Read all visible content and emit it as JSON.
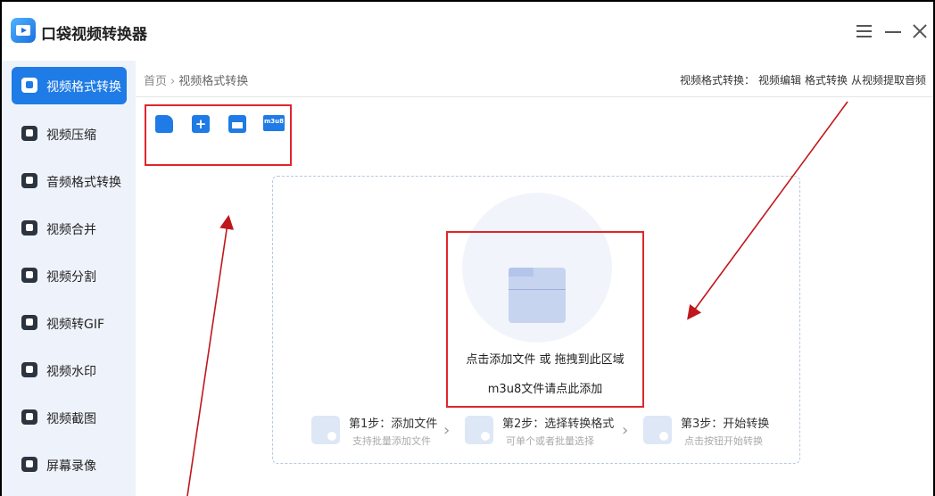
{
  "app": {
    "title": "口袋视频转换器"
  },
  "sidebar": {
    "items": [
      {
        "label": "视频格式转换",
        "icon": "video-convert-icon"
      },
      {
        "label": "视频压缩",
        "icon": "compress-icon"
      },
      {
        "label": "音频格式转换",
        "icon": "audio-convert-icon"
      },
      {
        "label": "视频合并",
        "icon": "merge-icon"
      },
      {
        "label": "视频分割",
        "icon": "split-icon"
      },
      {
        "label": "视频转GIF",
        "icon": "gif-icon"
      },
      {
        "label": "视频水印",
        "icon": "watermark-icon"
      },
      {
        "label": "视频截图",
        "icon": "screenshot-icon"
      },
      {
        "label": "屏幕录像",
        "icon": "screen-record-icon"
      }
    ]
  },
  "breadcrumb": {
    "home": "首页",
    "separator": "›",
    "current": "视频格式转换"
  },
  "header_links": {
    "prefix": "视频格式转换：",
    "items": [
      "视频编辑",
      "格式转换",
      "从视频提取音频"
    ]
  },
  "toolbar": {
    "icons": [
      "add-file-icon",
      "add-folder-icon",
      "batch-icon",
      "m3u8-icon"
    ],
    "m3u8_label": "m3u8"
  },
  "dropzone": {
    "text": "点击添加文件 或 拖拽到此区域",
    "m3u8_text": "m3u8文件请点此添加"
  },
  "steps": [
    {
      "title": "第1步：添加文件",
      "desc": "支持批量添加文件"
    },
    {
      "title": "第2步：选择转换格式",
      "desc": "可单个或者批量选择"
    },
    {
      "title": "第3步：开始转换",
      "desc": "点击按钮开始转换"
    }
  ],
  "colors": {
    "accent": "#1f7be5",
    "annotation": "#e0262a",
    "sidebar_bg": "#eef3fb"
  }
}
